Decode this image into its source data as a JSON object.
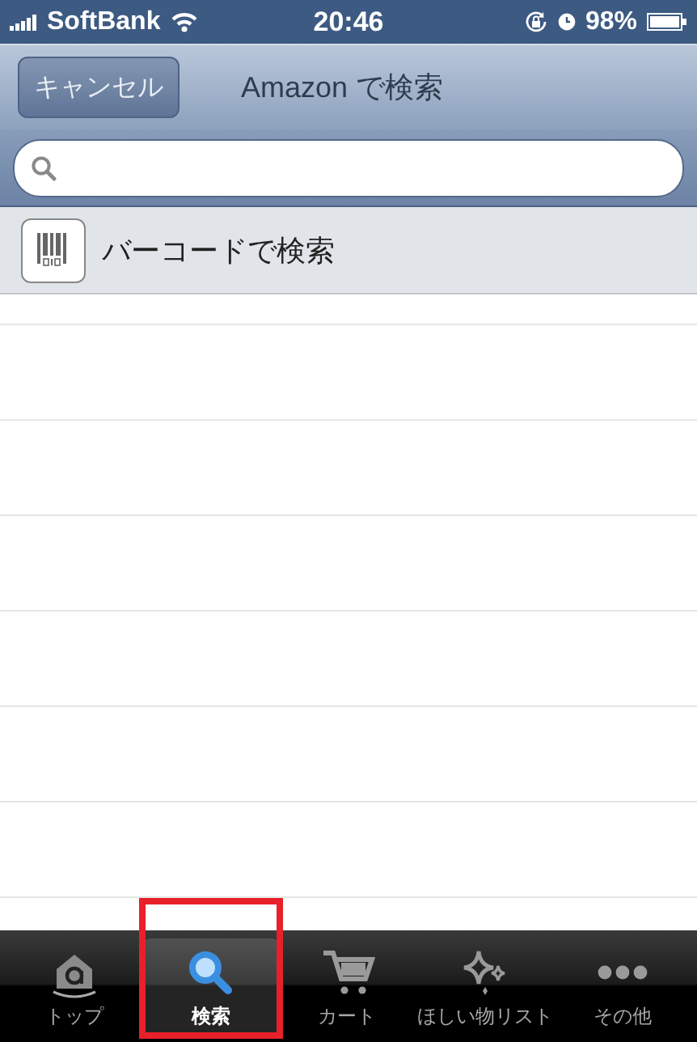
{
  "status_bar": {
    "carrier": "SoftBank",
    "time": "20:46",
    "battery": "98%"
  },
  "nav_bar": {
    "title": "Amazon で検索",
    "cancel_button": "キャンセル"
  },
  "results": [
    {
      "label": "バーコードで検索",
      "kind": "barcode"
    }
  ],
  "tabs": [
    {
      "label": "トップ",
      "kind": "home",
      "selected": false,
      "marked": false
    },
    {
      "label": "検索",
      "kind": "search",
      "selected": true,
      "marked": true
    },
    {
      "label": "カート",
      "kind": "cart",
      "selected": false,
      "marked": false
    },
    {
      "label": "ほしい物リスト",
      "kind": "sparkle",
      "selected": false,
      "marked": false
    },
    {
      "label": "その他",
      "kind": "more",
      "selected": false,
      "marked": false
    }
  ]
}
